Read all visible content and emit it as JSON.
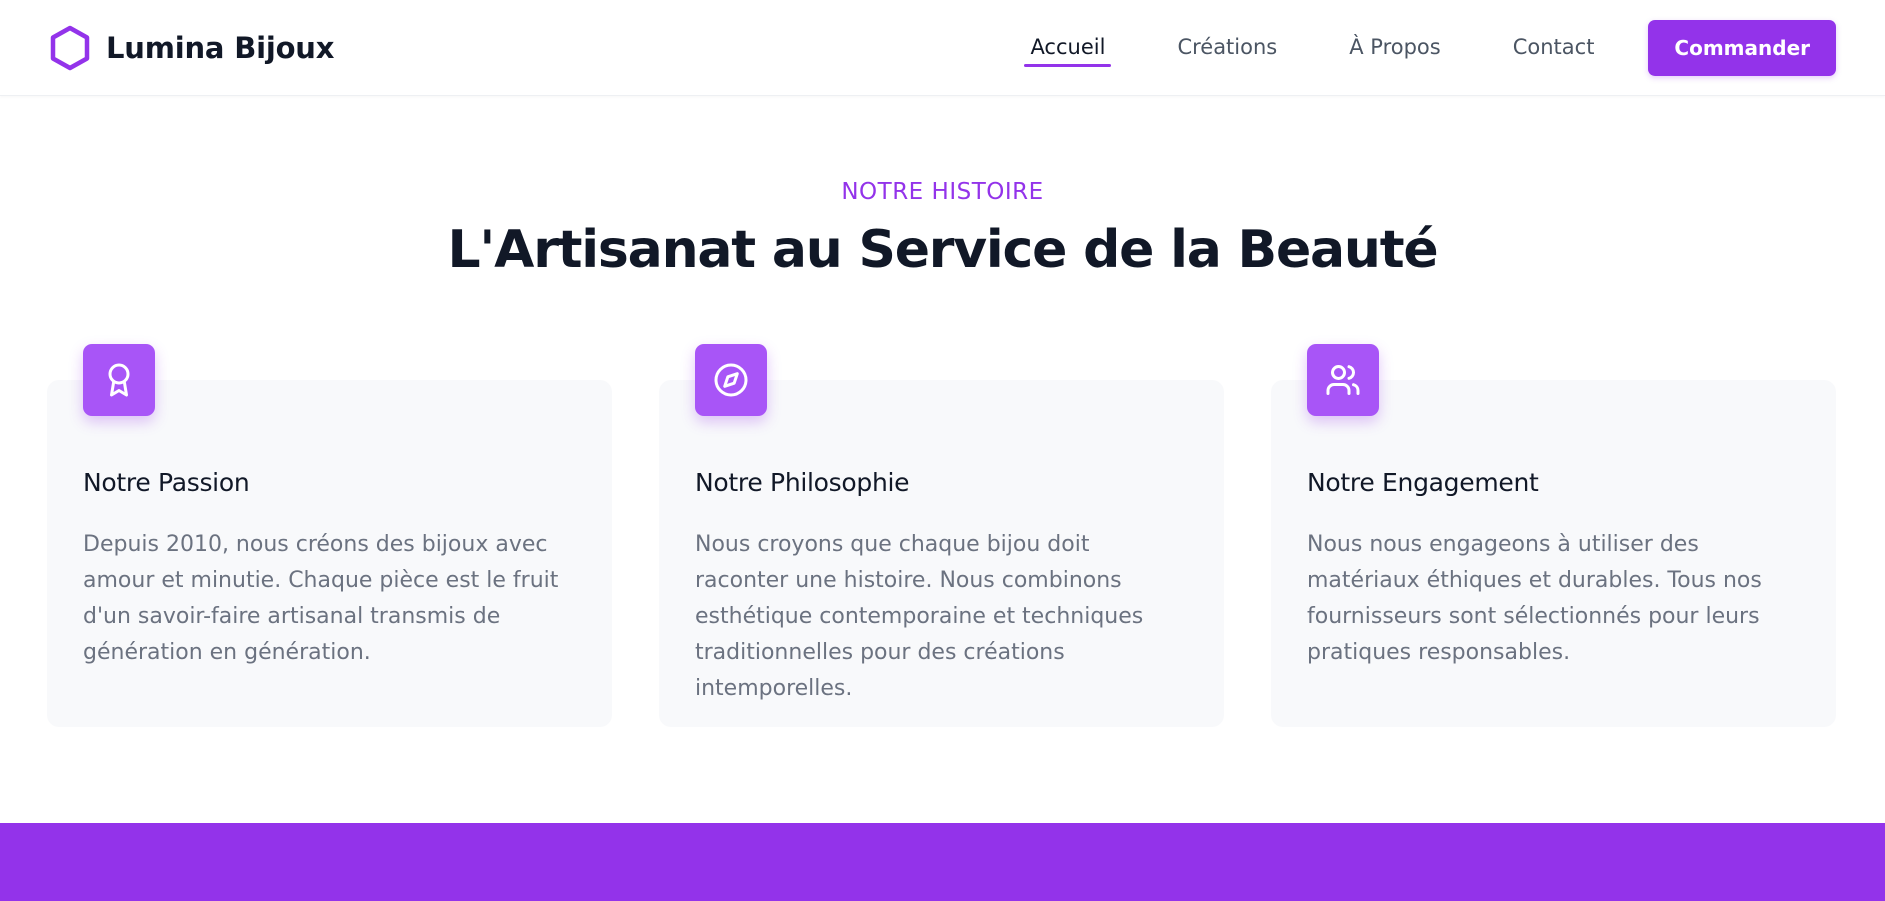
{
  "colors": {
    "accent": "#9333ea",
    "icon_tile": "#a855f7",
    "heading": "#111827",
    "body_text": "#6b7280",
    "card_bg": "#f8f9fb"
  },
  "header": {
    "brand": "Lumina Bijoux",
    "logo_icon": "hexagon-icon",
    "nav": [
      {
        "label": "Accueil",
        "active": true
      },
      {
        "label": "Créations",
        "active": false
      },
      {
        "label": "À Propos",
        "active": false
      },
      {
        "label": "Contact",
        "active": false
      }
    ],
    "cta_label": "Commander"
  },
  "story": {
    "eyebrow": "NOTRE HISTOIRE",
    "title": "L'Artisanat au Service de la Beauté",
    "cards": [
      {
        "icon": "award-icon",
        "title": "Notre Passion",
        "text": "Depuis 2010, nous créons des bijoux avec amour et minutie. Chaque pièce est le fruit d'un savoir-faire artisanal transmis de génération en génération."
      },
      {
        "icon": "compass-icon",
        "title": "Notre Philosophie",
        "text": "Nous croyons que chaque bijou doit raconter une histoire. Nous combinons esthétique contemporaine et techniques traditionnelles pour des créations intemporelles."
      },
      {
        "icon": "users-icon",
        "title": "Notre Engagement",
        "text": "Nous nous engageons à utiliser des matériaux éthiques et durables. Tous nos fournisseurs sont sélectionnés pour leurs pratiques responsables."
      }
    ]
  }
}
